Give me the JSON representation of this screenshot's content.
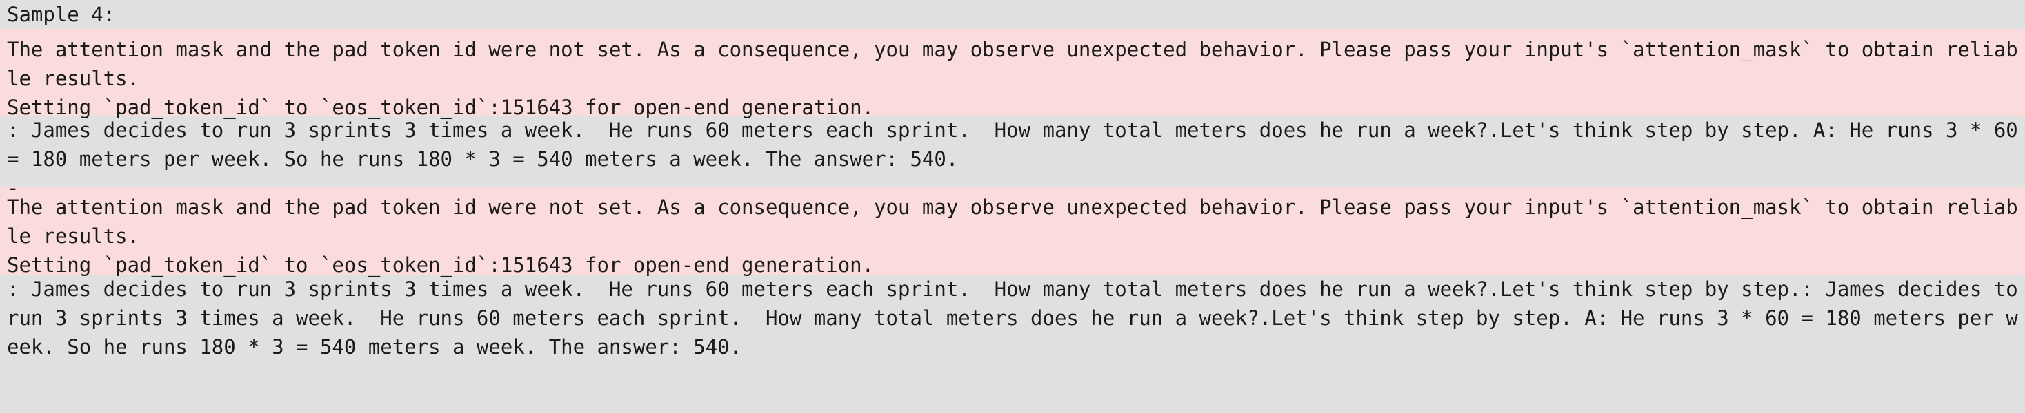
{
  "output": {
    "header": "Sample 4:",
    "blocks": [
      {
        "kind": "stderr",
        "text": "The attention mask and the pad token id were not set. As a consequence, you may observe unexpected behavior. Please pass your input's `attention_mask` to obtain reliable results.\nSetting `pad_token_id` to `eos_token_id`:151643 for open-end generation."
      },
      {
        "kind": "stdout",
        "text": ": James decides to run 3 sprints 3 times a week.  He runs 60 meters each sprint.  How many total meters does he run a week?.Let's think step by step. A: He runs 3 * 60 = 180 meters per week. So he runs 180 * 3 = 540 meters a week. The answer: 540.\n-"
      },
      {
        "kind": "stderr",
        "text": "The attention mask and the pad token id were not set. As a consequence, you may observe unexpected behavior. Please pass your input's `attention_mask` to obtain reliable results.\nSetting `pad_token_id` to `eos_token_id`:151643 for open-end generation."
      },
      {
        "kind": "stdout",
        "text": ": James decides to run 3 sprints 3 times a week.  He runs 60 meters each sprint.  How many total meters does he run a week?.Let's think step by step.: James decides to run 3 sprints 3 times a week.  He runs 60 meters each sprint.  How many total meters does he run a week?.Let's think step by step. A: He runs 3 * 60 = 180 meters per week. So he runs 180 * 3 = 540 meters a week. The answer: 540."
      }
    ]
  },
  "colors": {
    "stdout_background": "#e0e0e0",
    "stderr_background": "#fadcdc",
    "text": "#1a1a1a"
  }
}
